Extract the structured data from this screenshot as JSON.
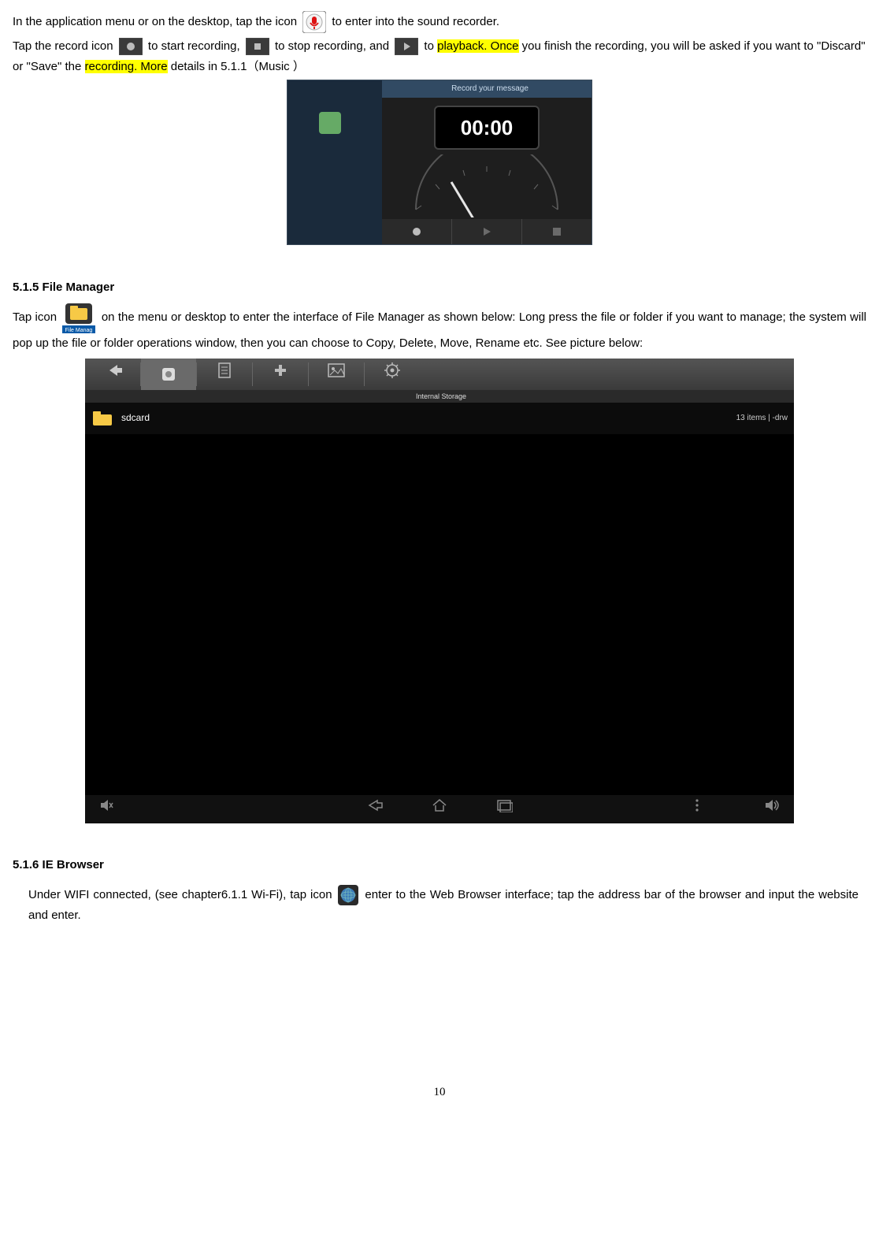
{
  "para1": {
    "t1": "In the application menu or on the desktop, tap the icon ",
    "t2": " to enter into the sound recorder."
  },
  "para2": {
    "t1": "Tap the record icon ",
    "t2": " to start recording, ",
    "t3": " to stop recording, and ",
    "t4": " to ",
    "hl1": "playback. Once",
    "t5": " you finish the recording, you will be asked if you want to \"Discard\" or \"Save\" the ",
    "hl2": "recording. More",
    "t6": " details in 5.1.1（Music ）"
  },
  "recorderShot": {
    "title": "Record your message",
    "time": "00:00"
  },
  "h515": "5.1.5 File Manager",
  "para3": {
    "t1": "Tap icon",
    "t2": " on the menu or desktop to enter the interface of File Manager as shown below: Long press the file or folder if you want to   manage; the system will pop up the file or folder operations window, then you can choose to Copy, Delete, Move, Rename etc. See picture below:"
  },
  "fmShot": {
    "storageLabel": "Internal Storage",
    "folder": "sdcard",
    "meta": "13 items | -drw"
  },
  "fmIconLabel": "File Manag",
  "h516": "5.1.6 IE Browser",
  "para4": {
    "t1": "Under WIFI connected, (see chapter6.1.1 Wi-Fi), tap icon ",
    "t2": " enter to the Web Browser interface; tap the address bar of the browser and input the website and enter."
  },
  "pageNumber": "10"
}
